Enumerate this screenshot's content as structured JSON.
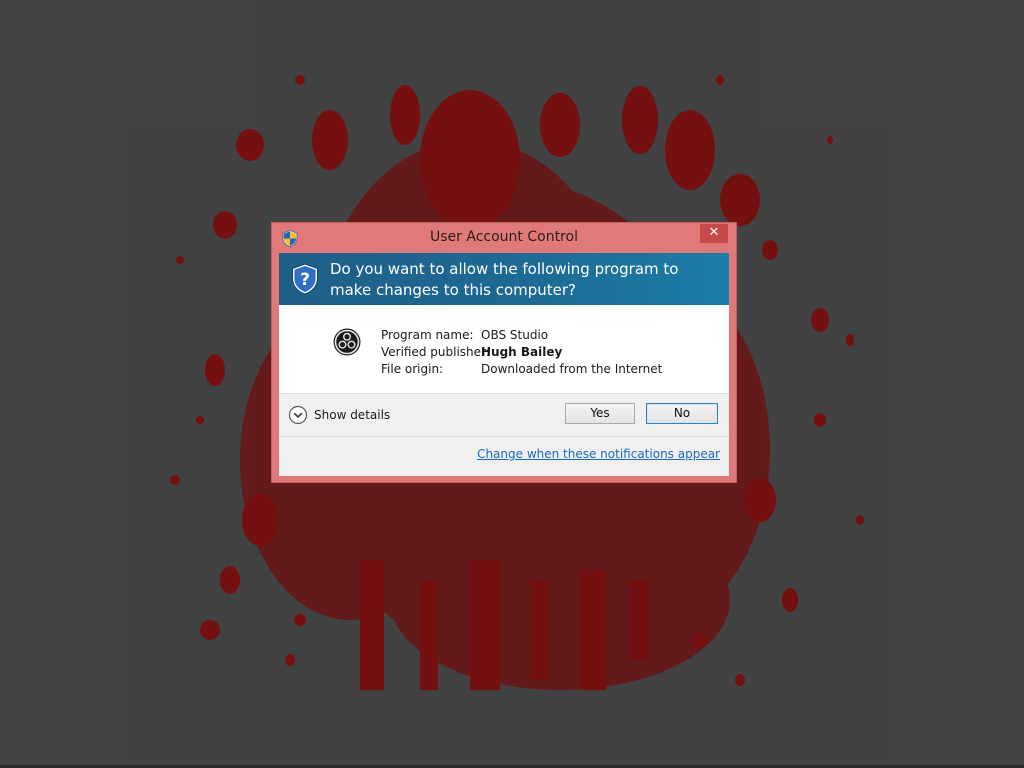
{
  "window": {
    "title": "User Account Control",
    "close_glyph": "✕"
  },
  "banner": {
    "question": "Do you want to allow the following program to make changes to this computer?",
    "icon": "uac-shield-icon"
  },
  "program": {
    "icon": "obs-studio-icon",
    "name_label": "Program name:",
    "name_value": "OBS Studio",
    "publisher_label": "Verified publisher:",
    "publisher_value": "Hugh Bailey",
    "origin_label": "File origin:",
    "origin_value": "Downloaded from the Internet"
  },
  "actions": {
    "show_details_label": "Show details",
    "yes_label": "Yes",
    "no_label": "No"
  },
  "footer": {
    "link_text": "Change when these notifications appear"
  },
  "colors": {
    "desktop_bg": "#474747",
    "splatter": "#8b1010",
    "window_frame": "#e07a7a",
    "close_button": "#c74a4a",
    "banner": "#1e6b95",
    "link": "#1a69b8"
  }
}
